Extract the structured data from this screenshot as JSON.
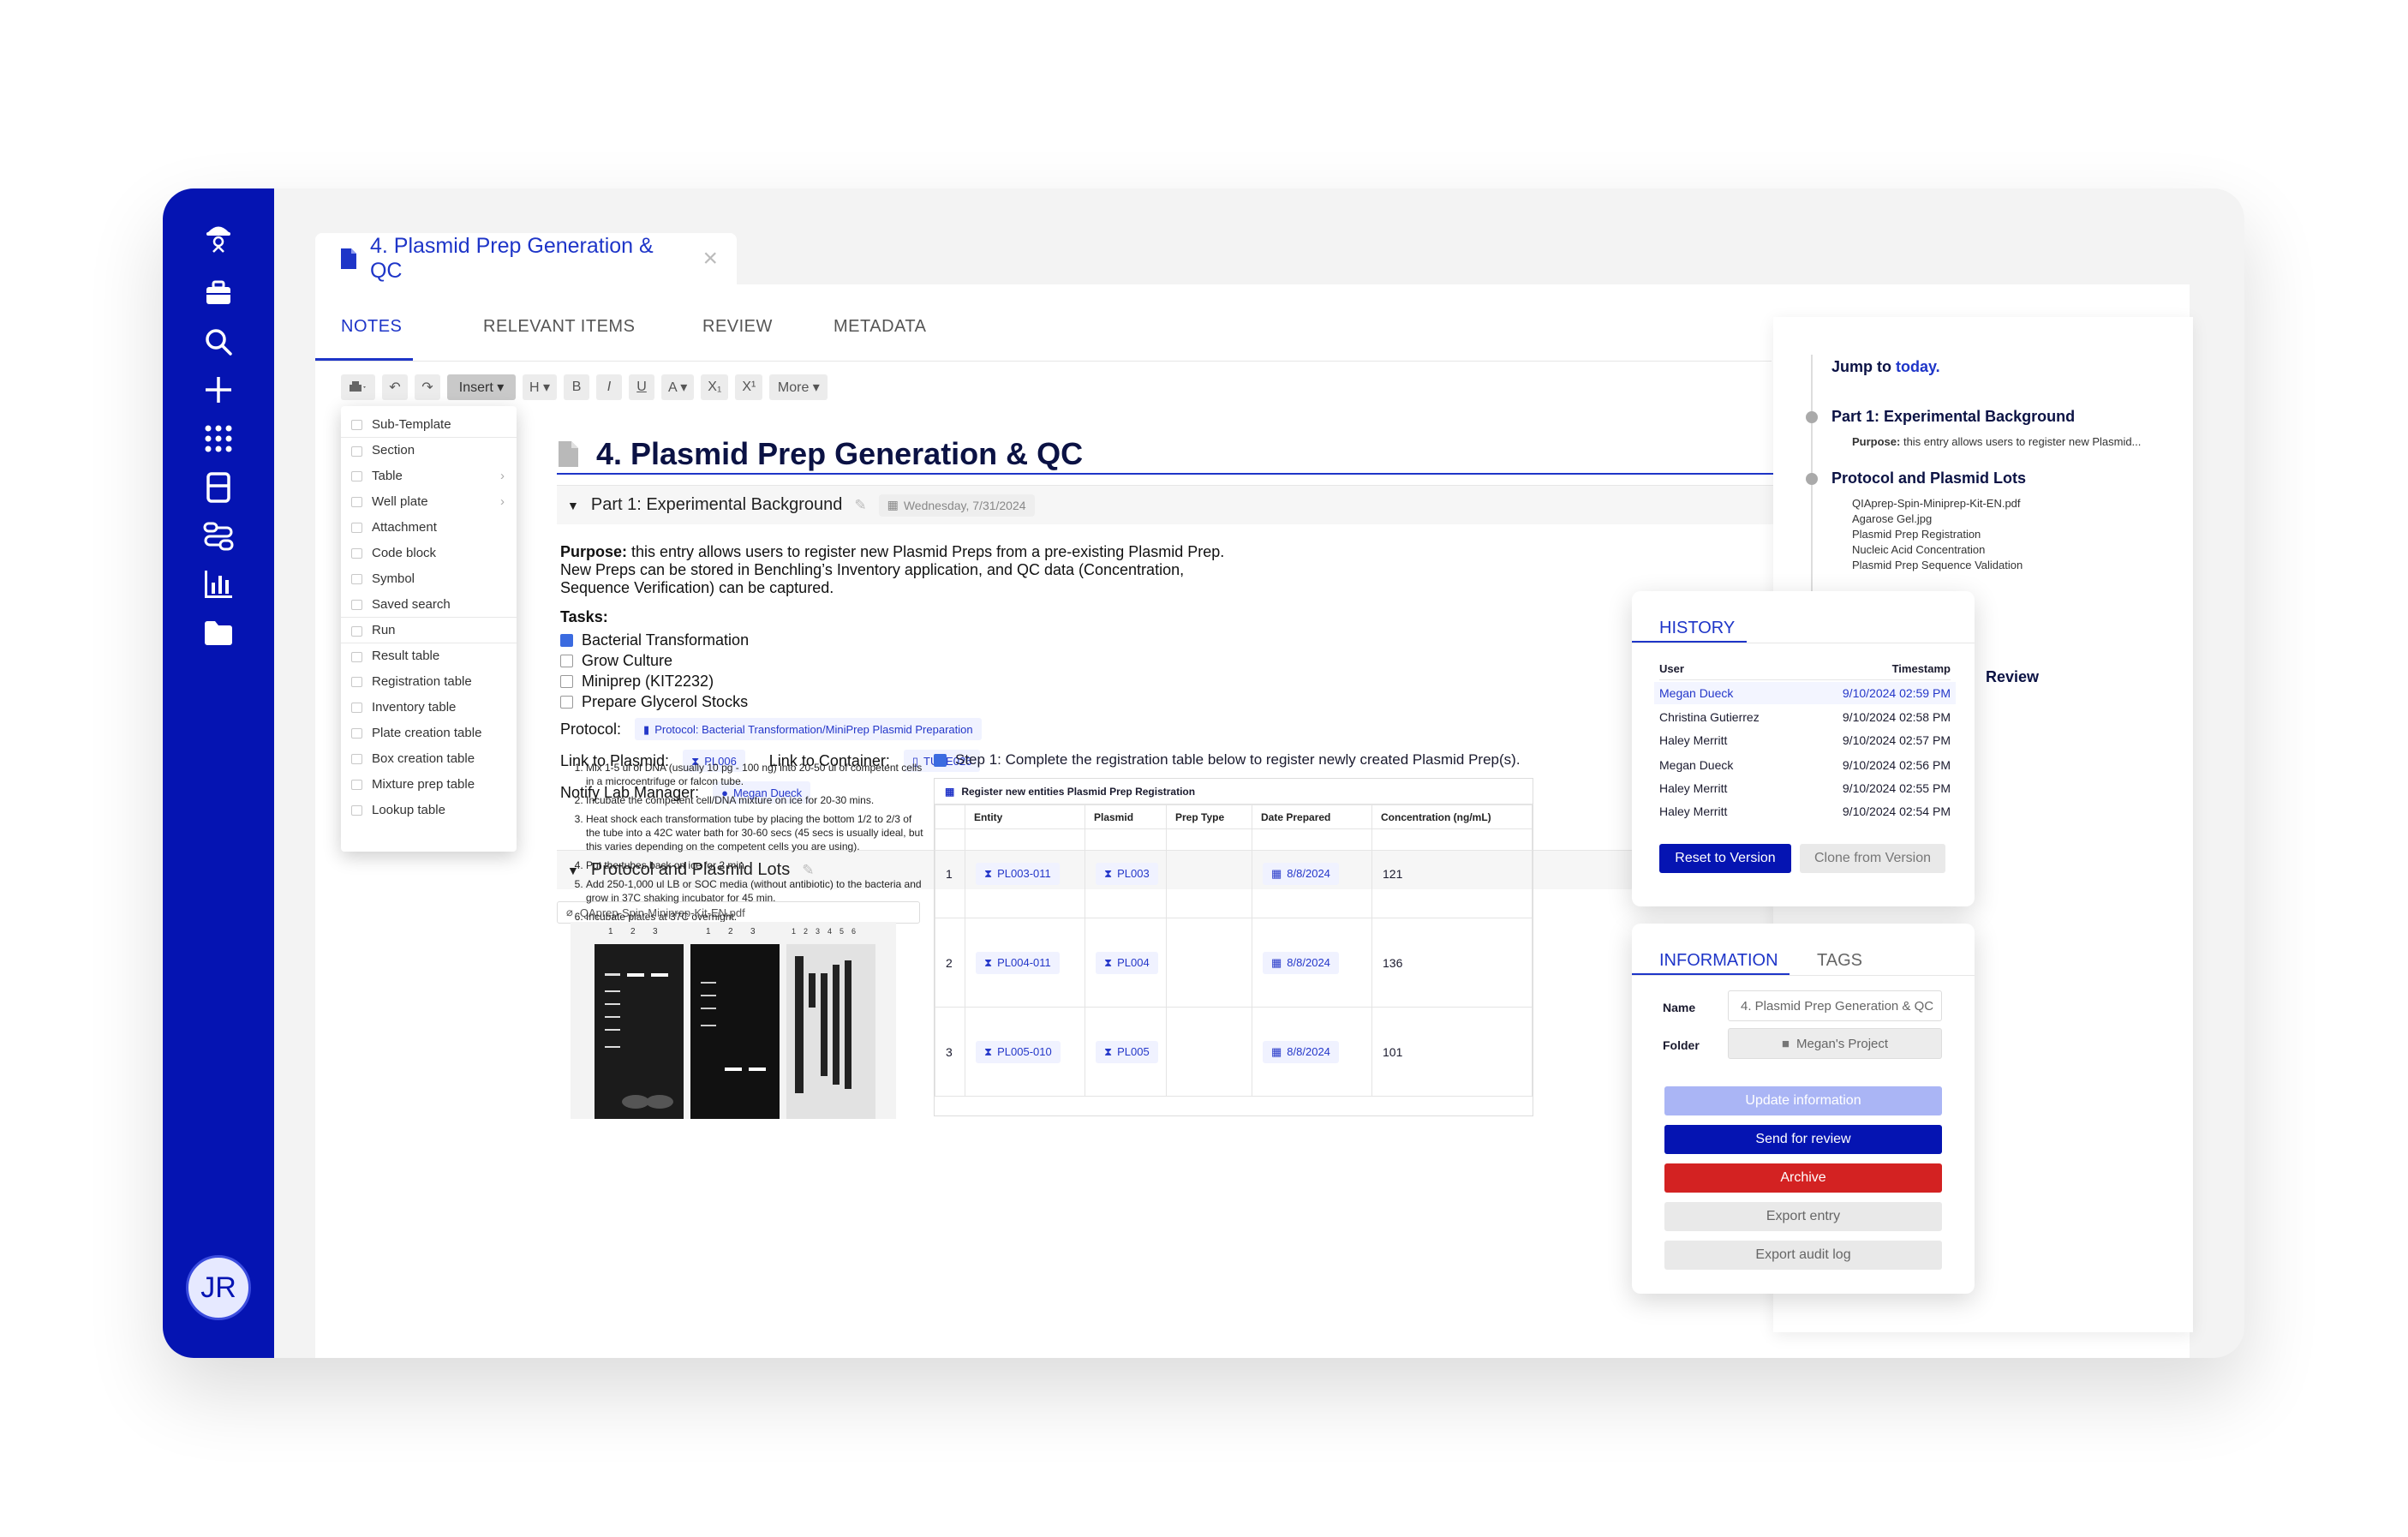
{
  "document_tab": {
    "title": "4. Plasmid Prep Generation & QC"
  },
  "subtabs": [
    "NOTES",
    "RELEVANT ITEMS",
    "REVIEW",
    "METADATA"
  ],
  "toolbar": {
    "insert": "Insert ▾",
    "heading": "H ▾",
    "bold": "B",
    "italic": "I",
    "underline": "U",
    "color": "A ▾",
    "subscript": "X₁",
    "superscript": "X¹",
    "more": "More ▾"
  },
  "insert_menu": [
    "Sub-Template",
    "Section",
    "Table",
    "Well plate",
    "Attachment",
    "Code block",
    "Symbol",
    "Saved search",
    "Run",
    "Result table",
    "Registration table",
    "Inventory table",
    "Plate creation table",
    "Box creation table",
    "Mixture prep table",
    "Lookup table"
  ],
  "entry": {
    "title": "4. Plasmid Prep Generation & QC",
    "section1": {
      "heading": "Part 1: Experimental Background",
      "date": "Wednesday, 7/31/2024"
    },
    "purpose_label": "Purpose:",
    "purpose_line1": " this entry allows users to register new Plasmid Preps from a pre-existing Plasmid Prep.",
    "purpose_line2": "New Preps can be stored in Benchling’s Inventory application, and QC data (Concentration,",
    "purpose_line3": "Sequence Verification) can be captured.",
    "tasks_label": "Tasks:",
    "tasks": [
      "Bacterial Transformation",
      "Grow Culture",
      "Miniprep (KIT2232)",
      "Prepare Glycerol Stocks"
    ],
    "protocol_label": "Protocol:",
    "protocol_value": "Protocol: Bacterial Transformation/MiniPrep Plasmid Preparation",
    "plasmid_label": "Link to Plasmid:",
    "plasmid_value": "PL006",
    "container_label": "Link to Container:",
    "container_value": "TUBE026",
    "manager_label": "Notify Lab Manager:",
    "manager_value": "Megan Dueck",
    "section2": {
      "heading": "Protocol and Plasmid Lots"
    },
    "attachment": "QAprep-Spin-Miniprep-Kit-EN.pdf",
    "steps": [
      "Mix 1-5 ul of DNA (usually 10 pg - 100 ng) into 20-50 ul of competent cells in a microcentrifuge or falcon tube.",
      "Incubate the competent cell/DNA mixture on ice for 20-30 mins.",
      "Heat shock each transformation tube by placing the bottom 1/2 to 2/3 of the tube into a 42C water bath for 30-60 secs (45 secs is usually ideal, but this varies depending on the competent cells you are using).",
      "Put the tubes back on ice for 2 min.",
      "Add 250-1,000 ul LB or SOC media (without antibiotic) to the bacteria and grow in 37C shaking incubator for 45 min.",
      "Incubate plates at 37C overnight."
    ],
    "gel_lanes": [
      "1",
      "2",
      "3",
      "1",
      "2",
      "3",
      "1",
      "2",
      "3",
      "4",
      "5",
      "6"
    ],
    "step1_text": "Step 1: Complete the registration table below to register newly created Plasmid Prep(s).",
    "reg_table": {
      "title": "Register new entities Plasmid Prep Registration",
      "columns": [
        "Entity",
        "Plasmid",
        "Prep Type",
        "Date Prepared",
        "Concentration (ng/mL)"
      ],
      "rows": [
        {
          "n": "1",
          "entity": "PL003-011",
          "plasmid": "PL003",
          "prep": "",
          "date": "8/8/2024",
          "conc": "121"
        },
        {
          "n": "2",
          "entity": "PL004-011",
          "plasmid": "PL004",
          "prep": "",
          "date": "8/8/2024",
          "conc": "136"
        },
        {
          "n": "3",
          "entity": "PL005-010",
          "plasmid": "PL005",
          "prep": "",
          "date": "8/8/2024",
          "conc": "101"
        }
      ]
    }
  },
  "outline": {
    "jump_prefix": "Jump to ",
    "jump_link": "today.",
    "part1": "Part 1: Experimental Background",
    "part1_purpose_label": "Purpose:",
    "part1_purpose": " this entry allows users to register new Plasmid...",
    "part2": "Protocol and Plasmid Lots",
    "part2_items": [
      "QIAprep-Spin-Miniprep-Kit-EN.pdf",
      "Agarose Gel.jpg",
      "Plasmid Prep Registration",
      "Nucleic Acid Concentration",
      "Plasmid Prep Sequence Validation"
    ],
    "review": "Review"
  },
  "history": {
    "tab": "HISTORY",
    "col_user": "User",
    "col_timestamp": "Timestamp",
    "rows": [
      {
        "user": "Megan Dueck",
        "ts": "9/10/2024 02:59 PM"
      },
      {
        "user": "Christina Gutierrez",
        "ts": "9/10/2024 02:58 PM"
      },
      {
        "user": "Haley Merritt",
        "ts": "9/10/2024 02:57 PM"
      },
      {
        "user": "Megan Dueck",
        "ts": "9/10/2024 02:56 PM"
      },
      {
        "user": "Haley Merritt",
        "ts": "9/10/2024 02:55 PM"
      },
      {
        "user": "Haley Merritt",
        "ts": "9/10/2024 02:54 PM"
      }
    ],
    "reset_btn": "Reset to Version",
    "clone_btn": "Clone from Version"
  },
  "information": {
    "tab_info": "INFORMATION",
    "tab_tags": "TAGS",
    "name_label": "Name",
    "name_value": "4. Plasmid Prep Generation & QC",
    "folder_label": "Folder",
    "folder_value": "Megan's Project",
    "update_btn": "Update information",
    "review_btn": "Send for review",
    "archive_btn": "Archive",
    "export_btn": "Export entry",
    "audit_btn": "Export audit log"
  },
  "user": {
    "initials": "JR"
  },
  "colors": {
    "brand": "#0514b2",
    "accent": "#1e35c8",
    "archive": "#d32222"
  }
}
